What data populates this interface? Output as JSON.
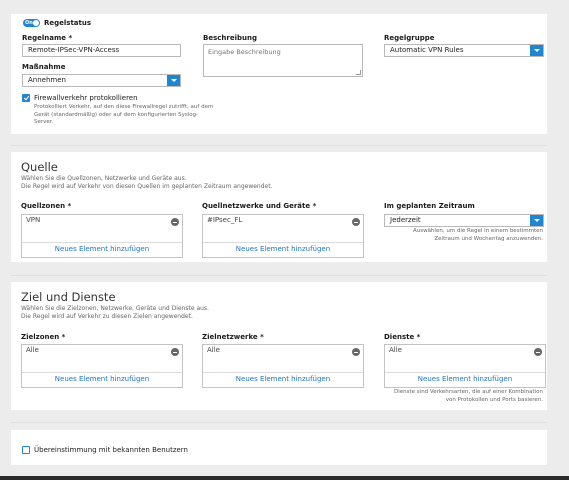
{
  "rule": {
    "toggle_label": "On",
    "status_label": "Regelstatus",
    "name_label": "Regelname *",
    "name_value": "Remote-IPSec-VPN-Access",
    "description_label": "Beschreibung",
    "description_placeholder": "Eingabe Beschreibung",
    "group_label": "Regelgruppe",
    "group_value": "Automatic VPN Rules",
    "action_label": "Maßnahme",
    "action_value": "Annehmen",
    "log_label": "Firewallverkehr protokollieren",
    "log_help": "Protokolliert Verkehr, auf den diese Firewallregel zutrifft, auf dem Gerät (standardmäßig) oder auf dem konfigurierten Syslog-Server.",
    "log_checked": true
  },
  "source": {
    "title": "Quelle",
    "desc1": "Wählen Sie die Quellzonen, Netzwerke und Geräte aus.",
    "desc2": "Die Regel wird auf Verkehr von diesen Quellen im geplanten Zeitraum angewendet.",
    "zones_label": "Quellzonen *",
    "zones_item": "VPN",
    "networks_label": "Quellnetzwerke und Geräte *",
    "networks_item": "#IPsec_FL",
    "schedule_label": "Im geplanten Zeitraum",
    "schedule_value": "Jederzeit",
    "schedule_help": "Auswählen, um die Regel in einem bestimmten Zeitraum und Wochentag anzuwenden.",
    "add_label": "Neues Element hinzufügen"
  },
  "dest": {
    "title": "Ziel und Dienste",
    "desc1": "Wählen Sie die Zielzonen, Netzwerke, Geräte und Dienste aus.",
    "desc2": "Die Regel wird auf Verkehr zu diesen Zielen angewendet.",
    "zones_label": "Zielzonen *",
    "zones_item": "Alle",
    "networks_label": "Zielnetzwerke *",
    "networks_item": "Alle",
    "services_label": "Dienste *",
    "services_item": "Alle",
    "services_help": "Dienste sind Verkehrsarten, die auf einer Kombination von Protokollen und Ports basieren.",
    "add_label": "Neues Element hinzufügen"
  },
  "users": {
    "match_label": "Übereinstimmung mit bekannten Benutzern",
    "match_checked": false
  },
  "colors": {
    "accent": "#1f86d3",
    "link": "#1f75c4"
  }
}
